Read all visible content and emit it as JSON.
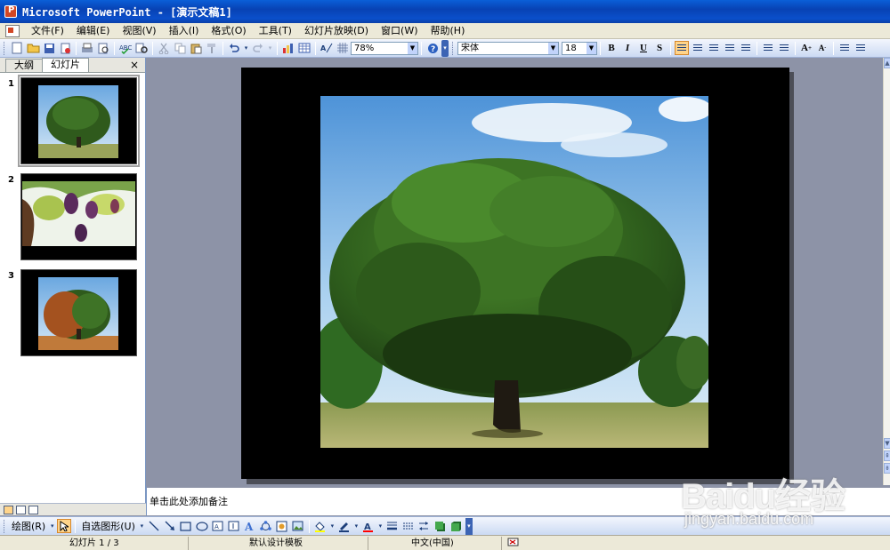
{
  "window": {
    "title": "Microsoft PowerPoint - [演示文稿1]"
  },
  "menu": {
    "items": [
      {
        "label": "文件(F)"
      },
      {
        "label": "编辑(E)"
      },
      {
        "label": "视图(V)"
      },
      {
        "label": "插入(I)"
      },
      {
        "label": "格式(O)"
      },
      {
        "label": "工具(T)"
      },
      {
        "label": "幻灯片放映(D)"
      },
      {
        "label": "窗口(W)"
      },
      {
        "label": "帮助(H)"
      }
    ]
  },
  "toolbar": {
    "zoom": "78%",
    "font_name": "宋体",
    "font_size": "18",
    "bold": "B",
    "italic": "I",
    "underline": "U",
    "shadow": "S"
  },
  "left_pane": {
    "tabs": [
      "大纲",
      "幻灯片"
    ],
    "active_tab": "幻灯片",
    "close": "×",
    "slides": [
      {
        "number": "1",
        "selected": true
      },
      {
        "number": "2",
        "selected": false
      },
      {
        "number": "3",
        "selected": false
      }
    ]
  },
  "notes": {
    "placeholder": "单击此处添加备注"
  },
  "draw_toolbar": {
    "draw_label": "绘图(R)",
    "autoshapes_label": "自选图形(U)"
  },
  "status": {
    "slide": "幻灯片 1 / 3",
    "design": "默认设计模板",
    "language": "中文(中国)"
  },
  "watermark": {
    "logo": "Baidu经验",
    "url": "jingyan.baidu.com"
  },
  "colors": {
    "titlebar": "#0a4fcb",
    "workspace": "#8d93a7",
    "toolbar": "#cbdaf3"
  }
}
